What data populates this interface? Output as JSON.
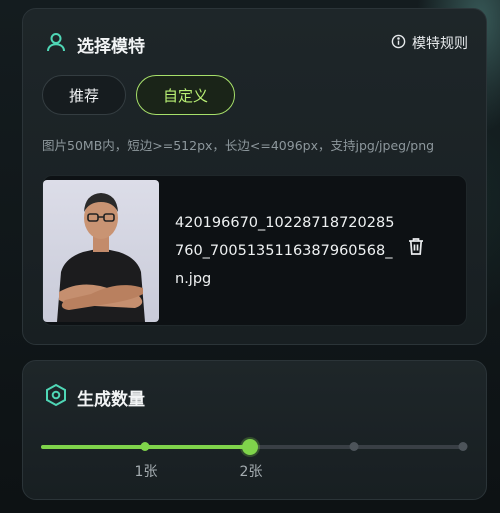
{
  "model_section": {
    "title": "选择模特",
    "rules_label": "模特规则",
    "tabs": [
      {
        "label": "推荐",
        "active": false
      },
      {
        "label": "自定义",
        "active": true
      }
    ],
    "upload_hint": "图片50MB内，短边>=512px，长边<=4096px，支持jpg/jpeg/png",
    "uploaded_file": {
      "name": "420196670_10228718720285760_7005135116387960568_n.jpg"
    }
  },
  "count_section": {
    "title": "生成数量",
    "slider": {
      "selected": 2,
      "marks": [
        "1张",
        "2张"
      ],
      "fill_fraction": 0.5
    }
  },
  "colors": {
    "accent": "#7fd44b",
    "active_tab_text": "#b8ef74",
    "icon_teal": "#4fd6b5"
  },
  "icons": {
    "user": "user-icon",
    "info": "info-icon",
    "delete": "trash-icon",
    "hexagon": "hexagon-icon"
  }
}
